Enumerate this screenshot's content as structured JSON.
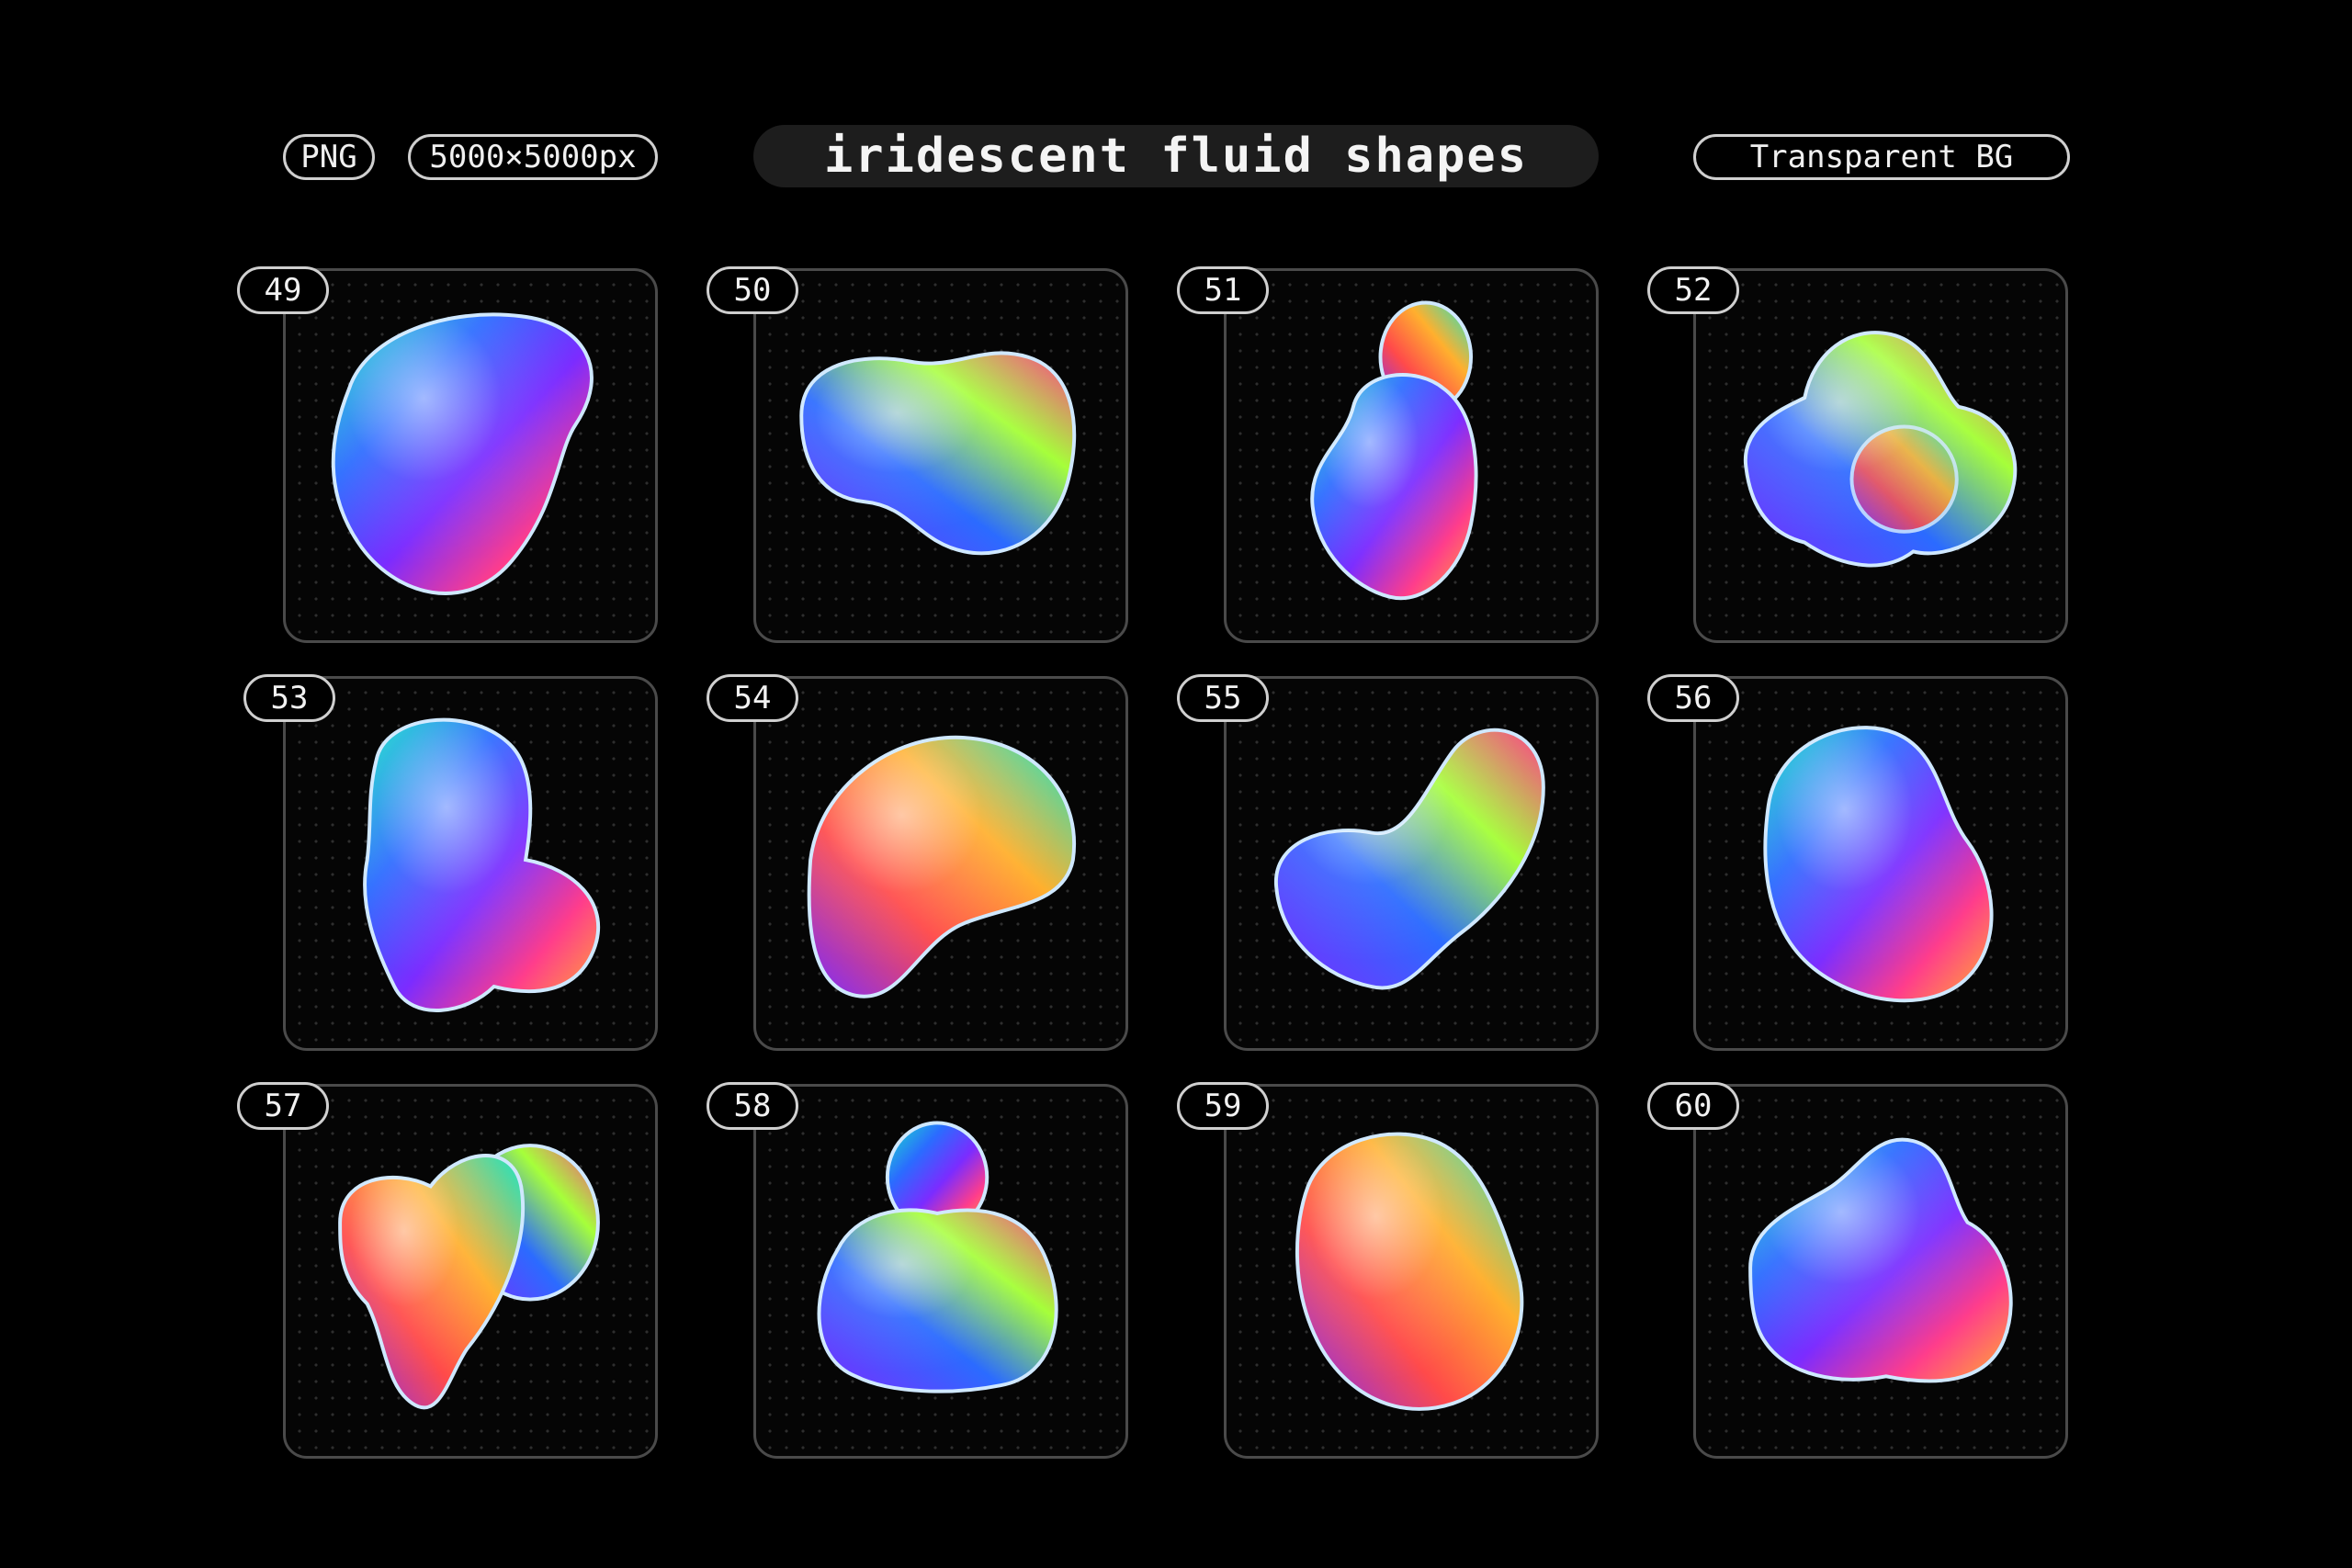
{
  "header": {
    "format_badge": "PNG",
    "size_badge": "5000×5000px",
    "title": "iridescent fluid shapes",
    "bg_badge": "Transparent BG"
  },
  "shapes": [
    {
      "number": "49"
    },
    {
      "number": "50"
    },
    {
      "number": "51"
    },
    {
      "number": "52"
    },
    {
      "number": "53"
    },
    {
      "number": "54"
    },
    {
      "number": "55"
    },
    {
      "number": "56"
    },
    {
      "number": "57"
    },
    {
      "number": "58"
    },
    {
      "number": "59"
    },
    {
      "number": "60"
    }
  ],
  "colors": {
    "background": "#000000",
    "card_border": "#4a4a4a",
    "badge_border": "#cfcfcf",
    "title_bar": "#1d1d1d",
    "iridescent": [
      "#ff3d8b",
      "#7b2cff",
      "#2b6bff",
      "#17e6c8",
      "#a6ff3a",
      "#ffb02e",
      "#ff4a4a"
    ]
  }
}
